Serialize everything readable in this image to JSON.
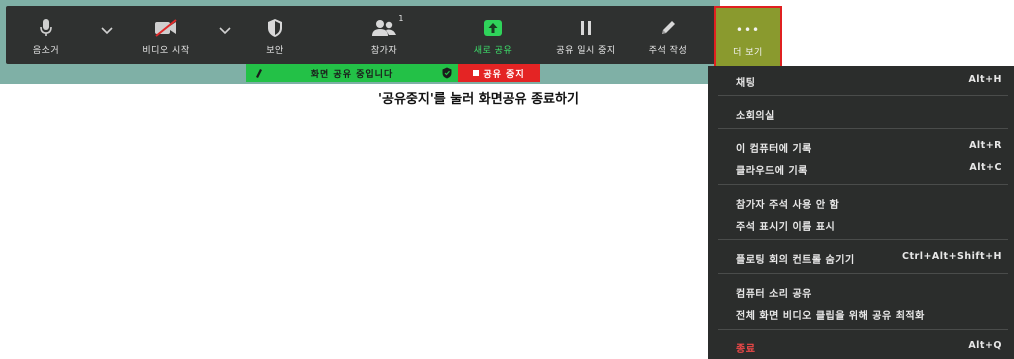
{
  "toolbar": {
    "mute_label": "음소거",
    "video_label": "비디오 시작",
    "security_label": "보안",
    "participants_label": "참가자",
    "participants_count": "1",
    "new_share_label": "새로 공유",
    "pause_share_label": "공유 일시 중지",
    "annotate_label": "주석 작성",
    "more_label": "더 보기",
    "more_glyph": "•••"
  },
  "share_bar": {
    "status_text": "화면 공유 중입니다",
    "stop_label": "공유 중지"
  },
  "annotation_text": "'공유중지'를 눌러 화면공유 종료하기",
  "menu": {
    "items": [
      {
        "label": "채팅",
        "shortcut": "Alt+H"
      },
      {
        "label": "소회의실",
        "shortcut": ""
      },
      {
        "label": "이 컴퓨터에 기록",
        "shortcut": "Alt+R"
      },
      {
        "label": "클라우드에 기록",
        "shortcut": "Alt+C"
      },
      {
        "label": "참가자 주석 사용 안 함",
        "shortcut": ""
      },
      {
        "label": "주석 표시기 이름 표시",
        "shortcut": ""
      },
      {
        "label": "플로팅 회의 컨트롤 숨기기",
        "shortcut": "Ctrl+Alt+Shift+H"
      },
      {
        "label": "컴퓨터 소리 공유",
        "shortcut": ""
      },
      {
        "label": "전체 화면 비디오 클립을 위해 공유 최적화",
        "shortcut": ""
      },
      {
        "label": "종료",
        "shortcut": "Alt+Q"
      }
    ]
  },
  "colors": {
    "toolbar_bg": "#2f3130",
    "green": "#23c147",
    "stop_red": "#e42424",
    "more_highlight": "#8a9a2e",
    "menu_bg": "#2b2d2c"
  },
  "icons": [
    "microphone-icon",
    "video-off-icon",
    "shield-icon",
    "participants-icon",
    "share-up-arrow-icon",
    "pause-icon",
    "pencil-icon",
    "more-dots-icon"
  ]
}
